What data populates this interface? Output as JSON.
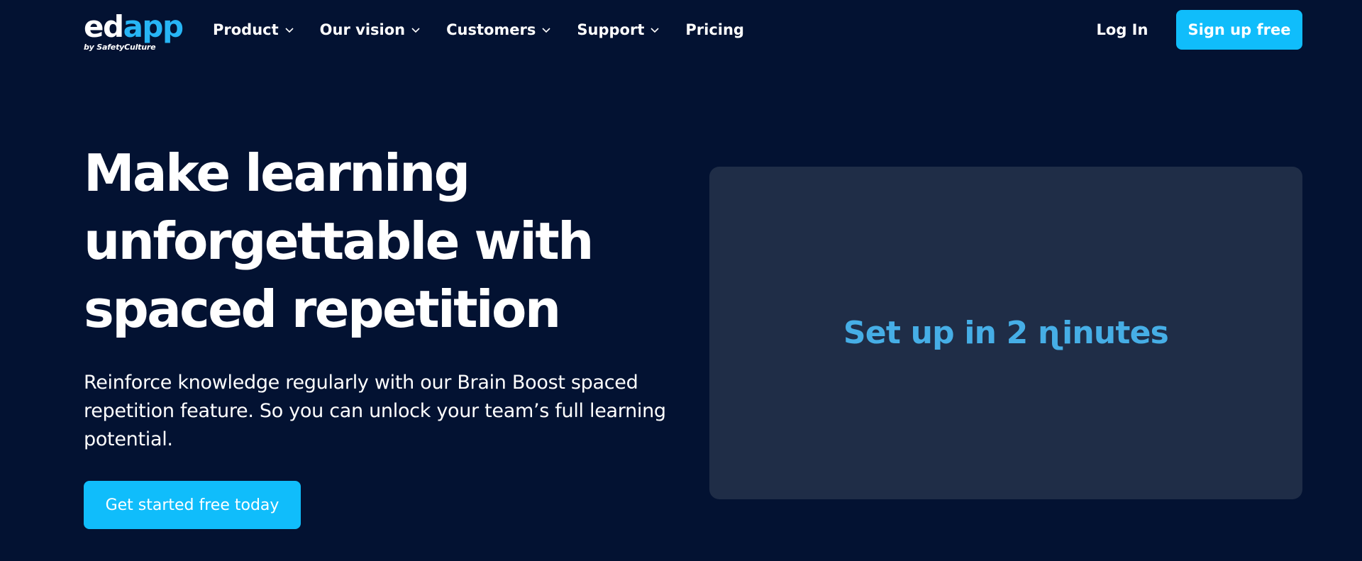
{
  "header": {
    "logo": {
      "part1": "ed",
      "part2": "app",
      "tagline": "by SafetyCulture",
      "colors": {
        "primary": "#ffffff",
        "accent": "#27b5f5"
      }
    },
    "nav": [
      {
        "label": "Product",
        "icon": "chevron-down-icon"
      },
      {
        "label": "Our vision",
        "icon": "chevron-down-icon"
      },
      {
        "label": "Customers",
        "icon": "chevron-down-icon"
      },
      {
        "label": "Support",
        "icon": "chevron-down-icon"
      },
      {
        "label": "Pricing"
      }
    ],
    "login_label": "Log In",
    "signup_label": "Sign up free"
  },
  "hero": {
    "title": "Make learning unforgettable with spaced repetition",
    "description": "Reinforce knowledge regularly with our Brain Boost spaced repetition feature. So you can unlock your team’s full learning potential.",
    "cta_label": "Get started free today"
  },
  "media": {
    "caption": "Set up in 2 ɳinutes"
  },
  "colors": {
    "background": "#031232",
    "button": "#10bdfb",
    "panel": "#1f2d47",
    "panel_text": "#46aee6"
  }
}
